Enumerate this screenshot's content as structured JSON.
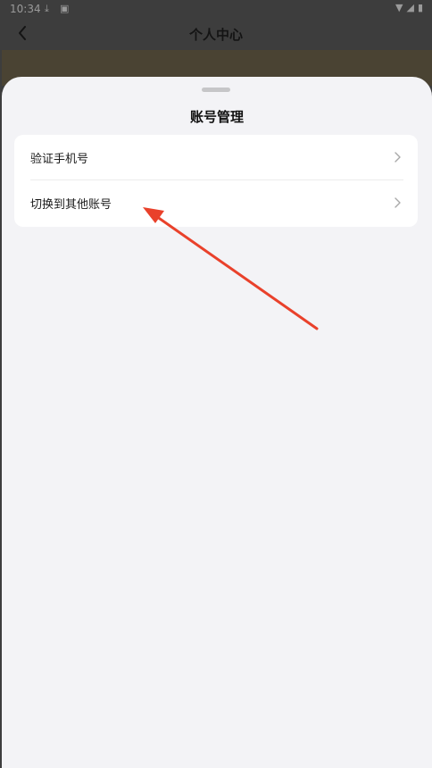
{
  "status_bar": {
    "time": "10:34"
  },
  "header": {
    "title": "个人中心"
  },
  "sheet": {
    "title": "账号管理",
    "items": [
      {
        "label": "验证手机号"
      },
      {
        "label": "切换到其他账号"
      }
    ]
  },
  "colors": {
    "annotation_arrow": "#e9412b",
    "sheet_background": "#f3f3f6",
    "card_background": "#ffffff"
  }
}
